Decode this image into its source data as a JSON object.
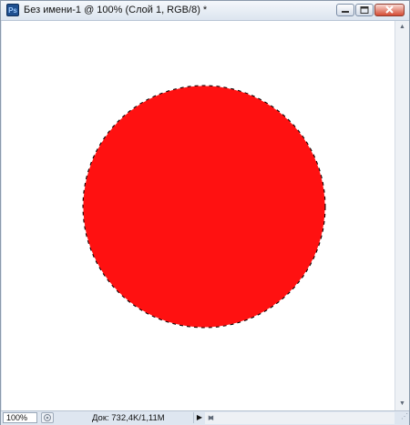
{
  "window": {
    "app_icon_label": "Ps",
    "title": "Без имени-1 @ 100% (Слой 1, RGB/8) *"
  },
  "canvas": {
    "background_color": "#ffffff",
    "shape": "circle",
    "fill_color": "#ff1111",
    "selection": "marching-ants"
  },
  "scrollbar": {
    "up_arrow": "▲",
    "down_arrow": "▼",
    "left_arrow": "◀",
    "right_arrow": "▶"
  },
  "statusbar": {
    "zoom": "100%",
    "doc_info": "Док: 732,4K/1,11M",
    "menu_arrow": "▶"
  }
}
